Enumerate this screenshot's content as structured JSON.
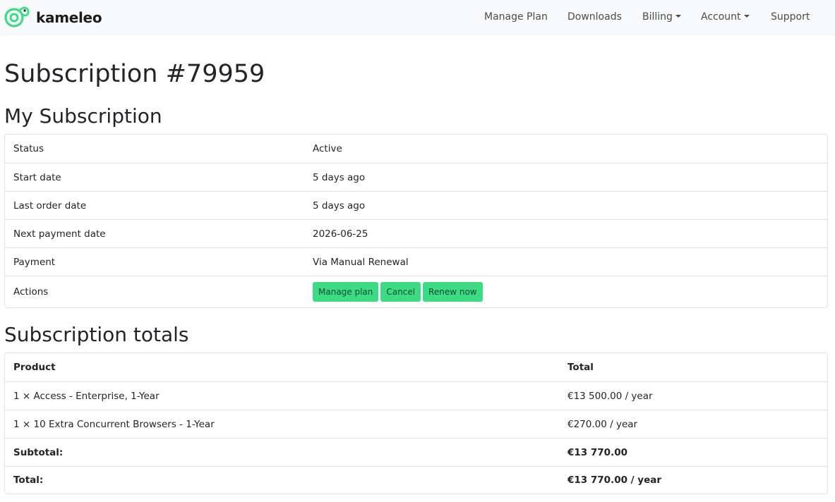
{
  "brand": {
    "name": "kameleo",
    "accent": "#3ddc84"
  },
  "nav": {
    "manage_plan": "Manage Plan",
    "downloads": "Downloads",
    "billing": "Billing",
    "account": "Account",
    "support": "Support"
  },
  "page": {
    "title": "Subscription #79959"
  },
  "subscription": {
    "heading": "My Subscription",
    "rows": [
      {
        "label": "Status",
        "value": "Active"
      },
      {
        "label": "Start date",
        "value": "5 days ago"
      },
      {
        "label": "Last order date",
        "value": "5 days ago"
      },
      {
        "label": "Next payment date",
        "value": "2026-06-25"
      },
      {
        "label": "Payment",
        "value": "Via Manual Renewal"
      }
    ],
    "actions_label": "Actions",
    "actions": {
      "manage": "Manage plan",
      "cancel": "Cancel",
      "renew": "Renew now"
    }
  },
  "totals": {
    "heading": "Subscription totals",
    "columns": {
      "product": "Product",
      "total": "Total"
    },
    "items": [
      {
        "product": "1 × Access - Enterprise, 1-Year",
        "total": "€13 500.00 / year"
      },
      {
        "product": "1 × 10 Extra Concurrent Browsers - 1-Year",
        "total": "€270.00 / year"
      }
    ],
    "subtotal": {
      "label": "Subtotal:",
      "value": "€13 770.00"
    },
    "total": {
      "label": "Total:",
      "value": "€13 770.00 / year"
    }
  }
}
